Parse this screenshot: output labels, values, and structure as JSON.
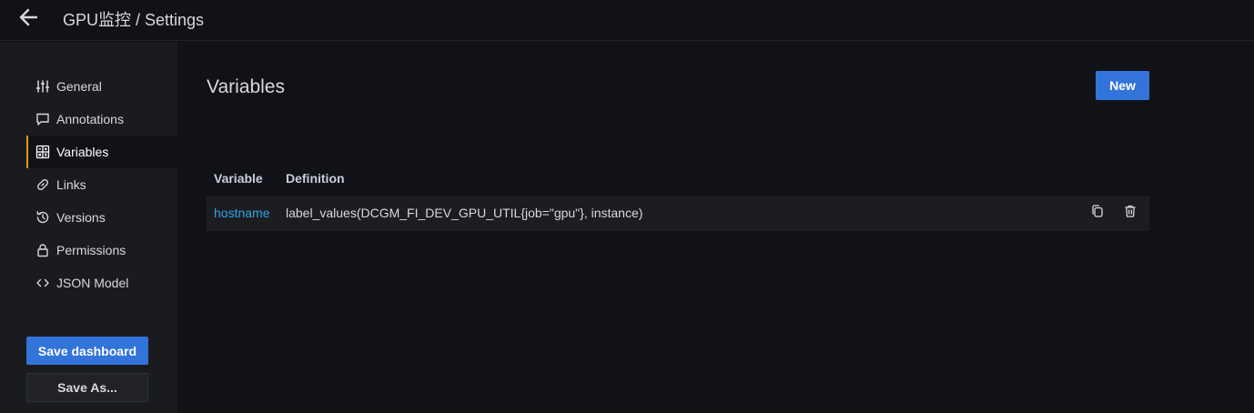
{
  "header": {
    "title": "GPU监控 / Settings",
    "back_icon": "arrow-left-icon"
  },
  "sidebar": {
    "items": [
      {
        "label": "General",
        "icon": "sliders-icon"
      },
      {
        "label": "Annotations",
        "icon": "comment-icon"
      },
      {
        "label": "Variables",
        "icon": "calculator-icon",
        "active": true
      },
      {
        "label": "Links",
        "icon": "link-icon"
      },
      {
        "label": "Versions",
        "icon": "history-icon"
      },
      {
        "label": "Permissions",
        "icon": "lock-icon"
      },
      {
        "label": "JSON Model",
        "icon": "code-brackets-icon"
      }
    ],
    "save_label": "Save dashboard",
    "save_as_label": "Save As..."
  },
  "main": {
    "title": "Variables",
    "new_label": "New",
    "table": {
      "columns": [
        "Variable",
        "Definition"
      ],
      "rows": [
        {
          "variable": "hostname",
          "definition": "label_values(DCGM_FI_DEV_GPU_UTIL{job=\"gpu\"}, instance)"
        }
      ]
    }
  },
  "colors": {
    "accent": "#3274d9",
    "active_border": "#f7941d",
    "link": "#33a2e5",
    "background": "#111217",
    "sidebar": "#1a1b1f"
  }
}
